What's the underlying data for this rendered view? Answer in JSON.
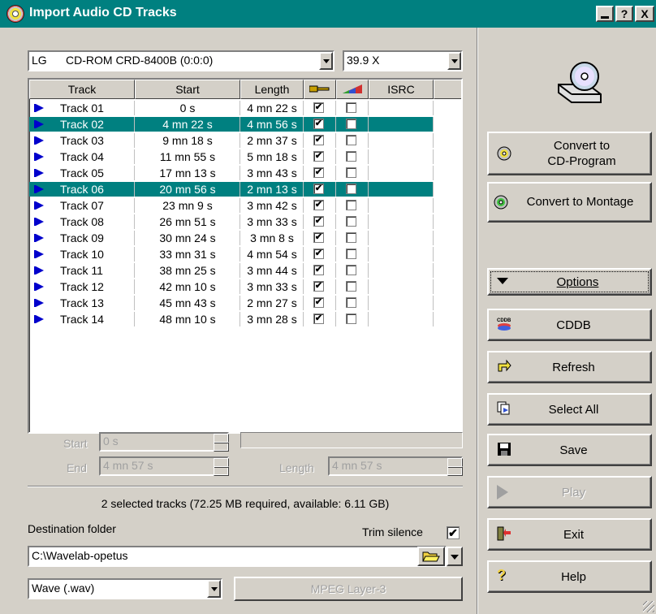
{
  "window": {
    "title": "Import Audio CD Tracks"
  },
  "titlebar_buttons": {
    "minimize": "",
    "help": "?",
    "close": "X"
  },
  "drive": {
    "selected": "LG      CD-ROM CRD-8400B (0:0:0)"
  },
  "speed": {
    "selected": "39.9 X"
  },
  "columns": {
    "track": "Track",
    "start": "Start",
    "length": "Length",
    "isrc": "ISRC"
  },
  "tracks": [
    {
      "name": "Track 01",
      "start": "0 s",
      "length": "4 mn 22 s",
      "selected": false
    },
    {
      "name": "Track 02",
      "start": "4 mn 22 s",
      "length": "4 mn 56 s",
      "selected": true
    },
    {
      "name": "Track 03",
      "start": "9 mn 18 s",
      "length": "2 mn 37 s",
      "selected": false
    },
    {
      "name": "Track 04",
      "start": "11 mn 55 s",
      "length": "5 mn 18 s",
      "selected": false
    },
    {
      "name": "Track 05",
      "start": "17 mn 13 s",
      "length": "3 mn 43 s",
      "selected": false
    },
    {
      "name": "Track 06",
      "start": "20 mn 56 s",
      "length": "2 mn 13 s",
      "selected": true
    },
    {
      "name": "Track 07",
      "start": "23 mn 9 s",
      "length": "3 mn 42 s",
      "selected": false
    },
    {
      "name": "Track 08",
      "start": "26 mn 51 s",
      "length": "3 mn 33 s",
      "selected": false
    },
    {
      "name": "Track 09",
      "start": "30 mn 24 s",
      "length": "3 mn 8 s",
      "selected": false
    },
    {
      "name": "Track 10",
      "start": "33 mn 31 s",
      "length": "4 mn 54 s",
      "selected": false
    },
    {
      "name": "Track 11",
      "start": "38 mn 25 s",
      "length": "3 mn 44 s",
      "selected": false
    },
    {
      "name": "Track 12",
      "start": "42 mn 10 s",
      "length": "3 mn 33 s",
      "selected": false
    },
    {
      "name": "Track 13",
      "start": "45 mn 43 s",
      "length": "2 mn 27 s",
      "selected": false
    },
    {
      "name": "Track 14",
      "start": "48 mn 10 s",
      "length": "3 mn 28 s",
      "selected": false
    }
  ],
  "range": {
    "start_label": "Start",
    "start_value": "0 s",
    "end_label": "End",
    "end_value": "4 mn 57 s",
    "length_label": "Length",
    "length_value": "4 mn 57 s"
  },
  "status": "2 selected tracks (72.25 MB required, available: 6.11 GB)",
  "destination": {
    "label": "Destination folder",
    "value": "C:\\Wavelab-opetus"
  },
  "trim_silence": {
    "label": "Trim silence",
    "checked": true
  },
  "format": {
    "selected": "Wave (.wav)",
    "encoder_button": "MPEG Layer-3"
  },
  "buttons": {
    "convert_program": "Convert to\nCD-Program",
    "convert_program_l1": "Convert to",
    "convert_program_l2": "CD-Program",
    "convert_montage": "Convert to Montage",
    "options": "Options",
    "cddb": "CDDB",
    "refresh": "Refresh",
    "select_all": "Select All",
    "save": "Save",
    "play": "Play",
    "exit": "Exit",
    "help": "Help"
  },
  "colors": {
    "titlebar": "#008080",
    "selection": "#008080",
    "face": "#d4d0c8"
  },
  "icons": {
    "title": "cd-icon",
    "drive": "cd-drive-icon",
    "key_col": "key-icon",
    "color_col": "color-ramp-icon",
    "convert_program": "cd-icon",
    "convert_montage": "cd-icon",
    "options": "triangle-down-icon",
    "cddb": "cddb-icon",
    "refresh": "refresh-arrow-icon",
    "select_all": "select-all-icon",
    "save": "floppy-disk-icon",
    "play": "play-icon",
    "exit": "exit-door-icon",
    "help": "question-mark-icon",
    "folder": "folder-open-icon"
  }
}
